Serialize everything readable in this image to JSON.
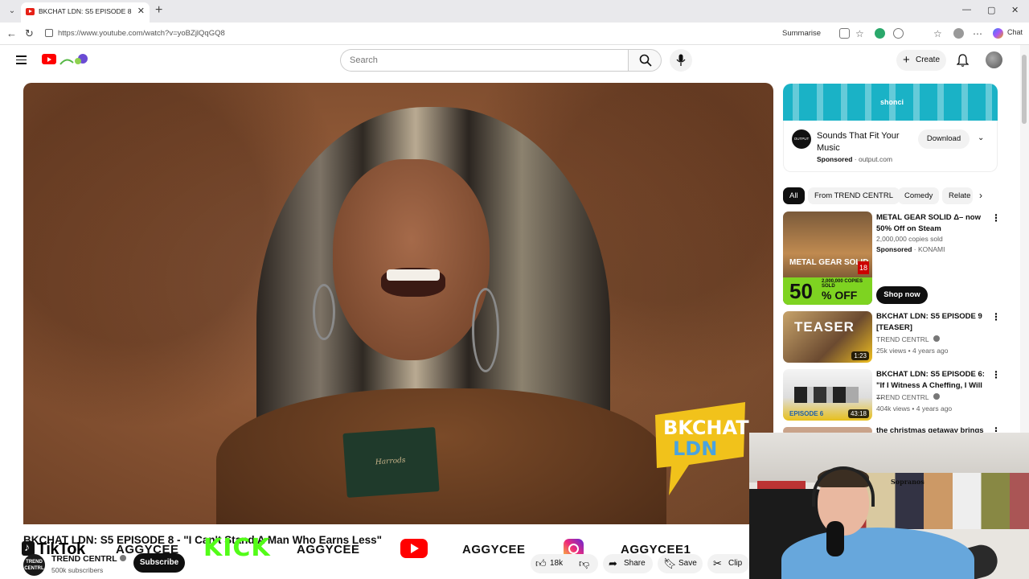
{
  "browser": {
    "tab_title": "BKCHAT LDN: S5 EPISODE 8 - \"I Ca",
    "tab_close": "✕",
    "new_tab": "+",
    "url": "https://www.youtube.com/watch?v=yoBZjlQqGQ8",
    "summarise_label": "Summarise",
    "chat_label": "Chat",
    "window_controls": [
      "—",
      "▢",
      "✕"
    ]
  },
  "header": {
    "search_placeholder": "Search",
    "create_label": "Create"
  },
  "video": {
    "title": "BKCHAT LDN: S5 EPISODE 8 - \"I Can't Stand A Man Who Earns Less\"",
    "card_text": "Harrods",
    "watermark_line1": "BKCHAT",
    "watermark_line2": "LDN"
  },
  "promo": {
    "tiktok_label": "TikTok",
    "tiktok_handle": "AGGYCEE",
    "kick_label": "KICK",
    "kick_handle": "AGGYCEE",
    "youtube_handle": "AGGYCEE",
    "instagram_handle": "AGGYCEE1"
  },
  "channel": {
    "avatar_text": "TREND CENTRL",
    "name": "TREND CENTRL",
    "subscribers": "500k subscribers",
    "subscribe_label": "Subscribe"
  },
  "actions": {
    "likes": "18k",
    "share_label": "Share",
    "save_label": "Save",
    "clip_label": "Clip"
  },
  "ad": {
    "banner_brand": "shonci",
    "logo_text": "OUTPUT",
    "title": "Sounds That Fit Your Music",
    "sponsored_label": "Sponsored",
    "domain": "output.com",
    "download_label": "Download"
  },
  "chips": [
    "All",
    "From TREND CENTRL",
    "Comedy",
    "Relate"
  ],
  "recommendations": [
    {
      "title": "METAL GEAR SOLID Δ– now 50% Off on Steam",
      "meta1": "2,000,000 copies sold",
      "sponsored": "Sponsored",
      "advertiser": "KONAMI",
      "shop_label": "Shop now",
      "thumb_logo": "METAL GEAR SOLID",
      "thumb_age": "18",
      "thumb_discount": "50",
      "thumb_off": "% OFF",
      "thumb_copies": "2,000,000 COPIES SOLD"
    },
    {
      "title": "BKCHAT LDN: S5 EPISODE 9 [TEASER]",
      "channel": "TREND CENTRL",
      "meta": "25k views • 4 years ago",
      "duration": "1:23",
      "thumb_text": "TEASER"
    },
    {
      "title": "BKCHAT LDN: S5 EPISODE 6: \"If I Witness A Cheffing, I Will ...",
      "channel": "TREND CENTRL",
      "meta": "404k views • 4 years ago",
      "duration": "43:18",
      "thumb_text": "EPISODE 6"
    },
    {
      "title": "the christmas getaway brings"
    }
  ],
  "webcam": {
    "poster_text": "Sopranos"
  },
  "colors": {
    "youtube_red": "#ff0000",
    "kick_green": "#53fc18",
    "ad_banner": "#1ab2c6",
    "shirt_blue": "#67a7dc"
  },
  "icons": {
    "search": "search-icon",
    "mic": "mic-icon",
    "bell": "bell-icon",
    "like": "thumbs-up-icon",
    "dislike": "thumbs-down-icon",
    "share": "share-icon",
    "save": "bookmark-icon",
    "clip": "scissors-icon"
  }
}
